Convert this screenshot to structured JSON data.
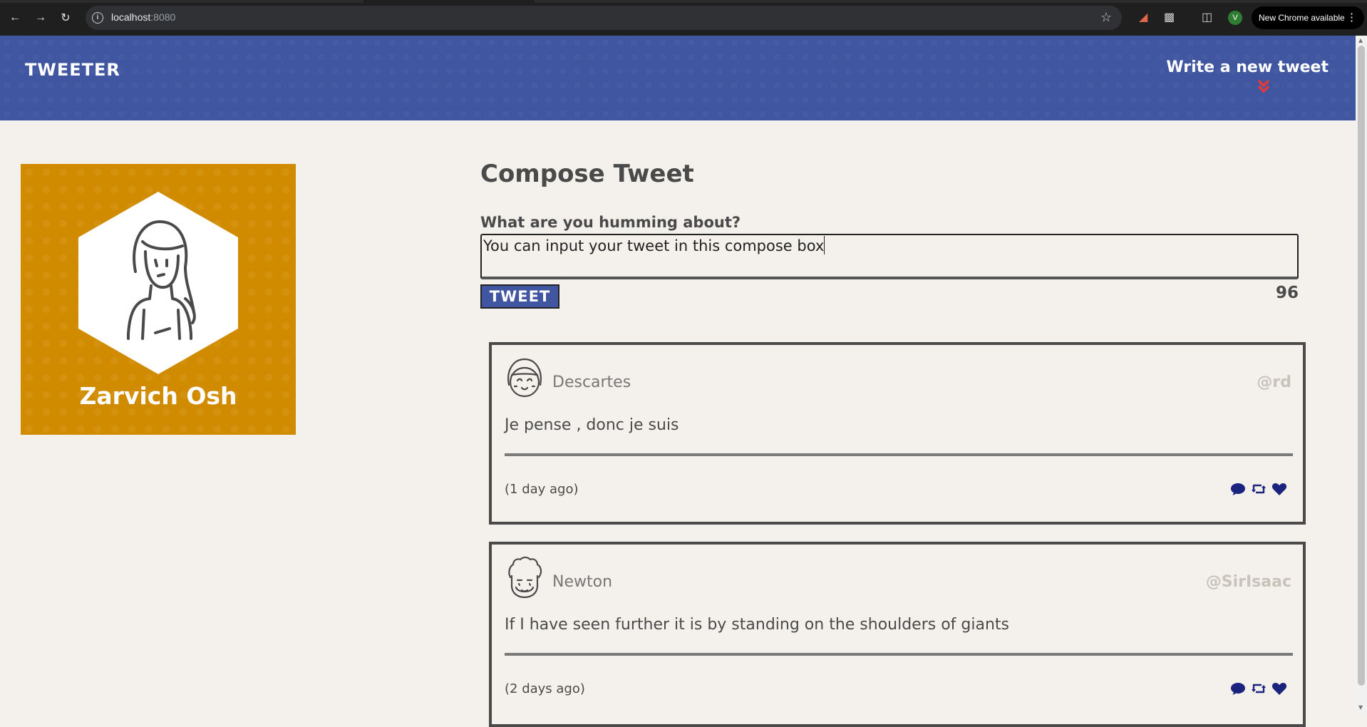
{
  "browser": {
    "url_host": "localhost",
    "url_port": ":8080",
    "profile_initial": "V",
    "update_label": "New Chrome available"
  },
  "header": {
    "logo": "TWEETER",
    "new_tweet_link": "Write a new tweet"
  },
  "profile": {
    "name": "Zarvich Osh"
  },
  "compose": {
    "title": "Compose Tweet",
    "label": "What are you humming about?",
    "input_value": "You can input your tweet in this compose box",
    "button_label": "TWEET",
    "char_counter": "96"
  },
  "tweets": [
    {
      "name": "Descartes",
      "handle": "@rd",
      "content": "Je pense , donc je suis",
      "timestamp": "(1 day ago)"
    },
    {
      "name": "Newton",
      "handle": "@SirIsaac",
      "content": "If I have seen further it is by standing on the shoulders of giants",
      "timestamp": "(2 days ago)"
    }
  ],
  "icons": {
    "comment": "comment-icon",
    "retweet": "retweet-icon",
    "like": "heart-icon",
    "chevron": "double-chevron-down-icon"
  },
  "colors": {
    "header_bg": "#4056a1",
    "profile_bg": "#d18b00",
    "page_bg": "#f4f1ec",
    "action_icons": "#1a237e",
    "chevron": "#e53935"
  }
}
